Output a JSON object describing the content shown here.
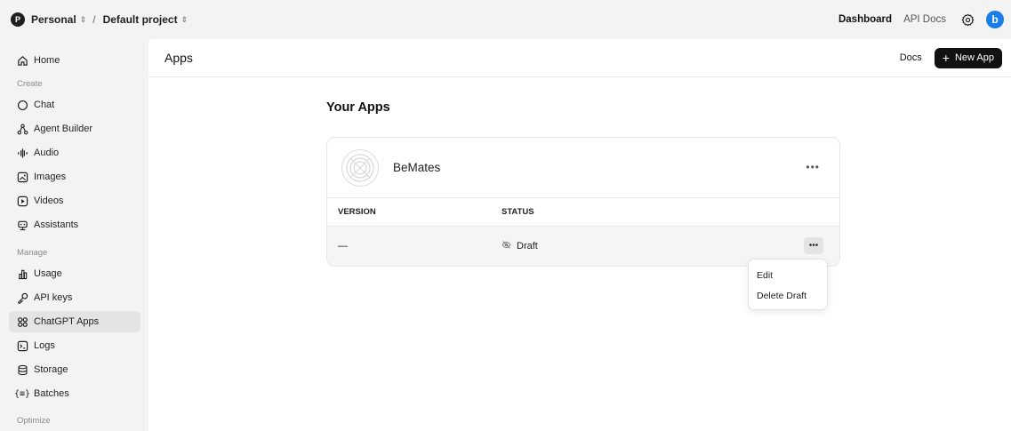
{
  "topbar": {
    "org_initial": "P",
    "org_name": "Personal",
    "project_name": "Default project",
    "separator": "/",
    "links": {
      "dashboard": "Dashboard",
      "api_docs": "API Docs"
    },
    "avatar_initial": "b",
    "avatar_color": "#1a7ee8"
  },
  "sidebar": {
    "home": "Home",
    "sections": {
      "create": "Create",
      "manage": "Manage",
      "optimize": "Optimize"
    },
    "create_items": [
      "Chat",
      "Agent Builder",
      "Audio",
      "Images",
      "Videos",
      "Assistants"
    ],
    "manage_items": [
      "Usage",
      "API keys",
      "ChatGPT Apps",
      "Logs",
      "Storage",
      "Batches"
    ],
    "active_item": "ChatGPT Apps"
  },
  "main": {
    "title": "Apps",
    "docs_label": "Docs",
    "new_app_label": "New App",
    "section_title": "Your Apps",
    "app": {
      "name": "BeMates",
      "columns": {
        "version": "VERSION",
        "status": "STATUS"
      },
      "row": {
        "version": "—",
        "status": "Draft"
      }
    },
    "menu": {
      "edit": "Edit",
      "delete": "Delete Draft"
    }
  }
}
